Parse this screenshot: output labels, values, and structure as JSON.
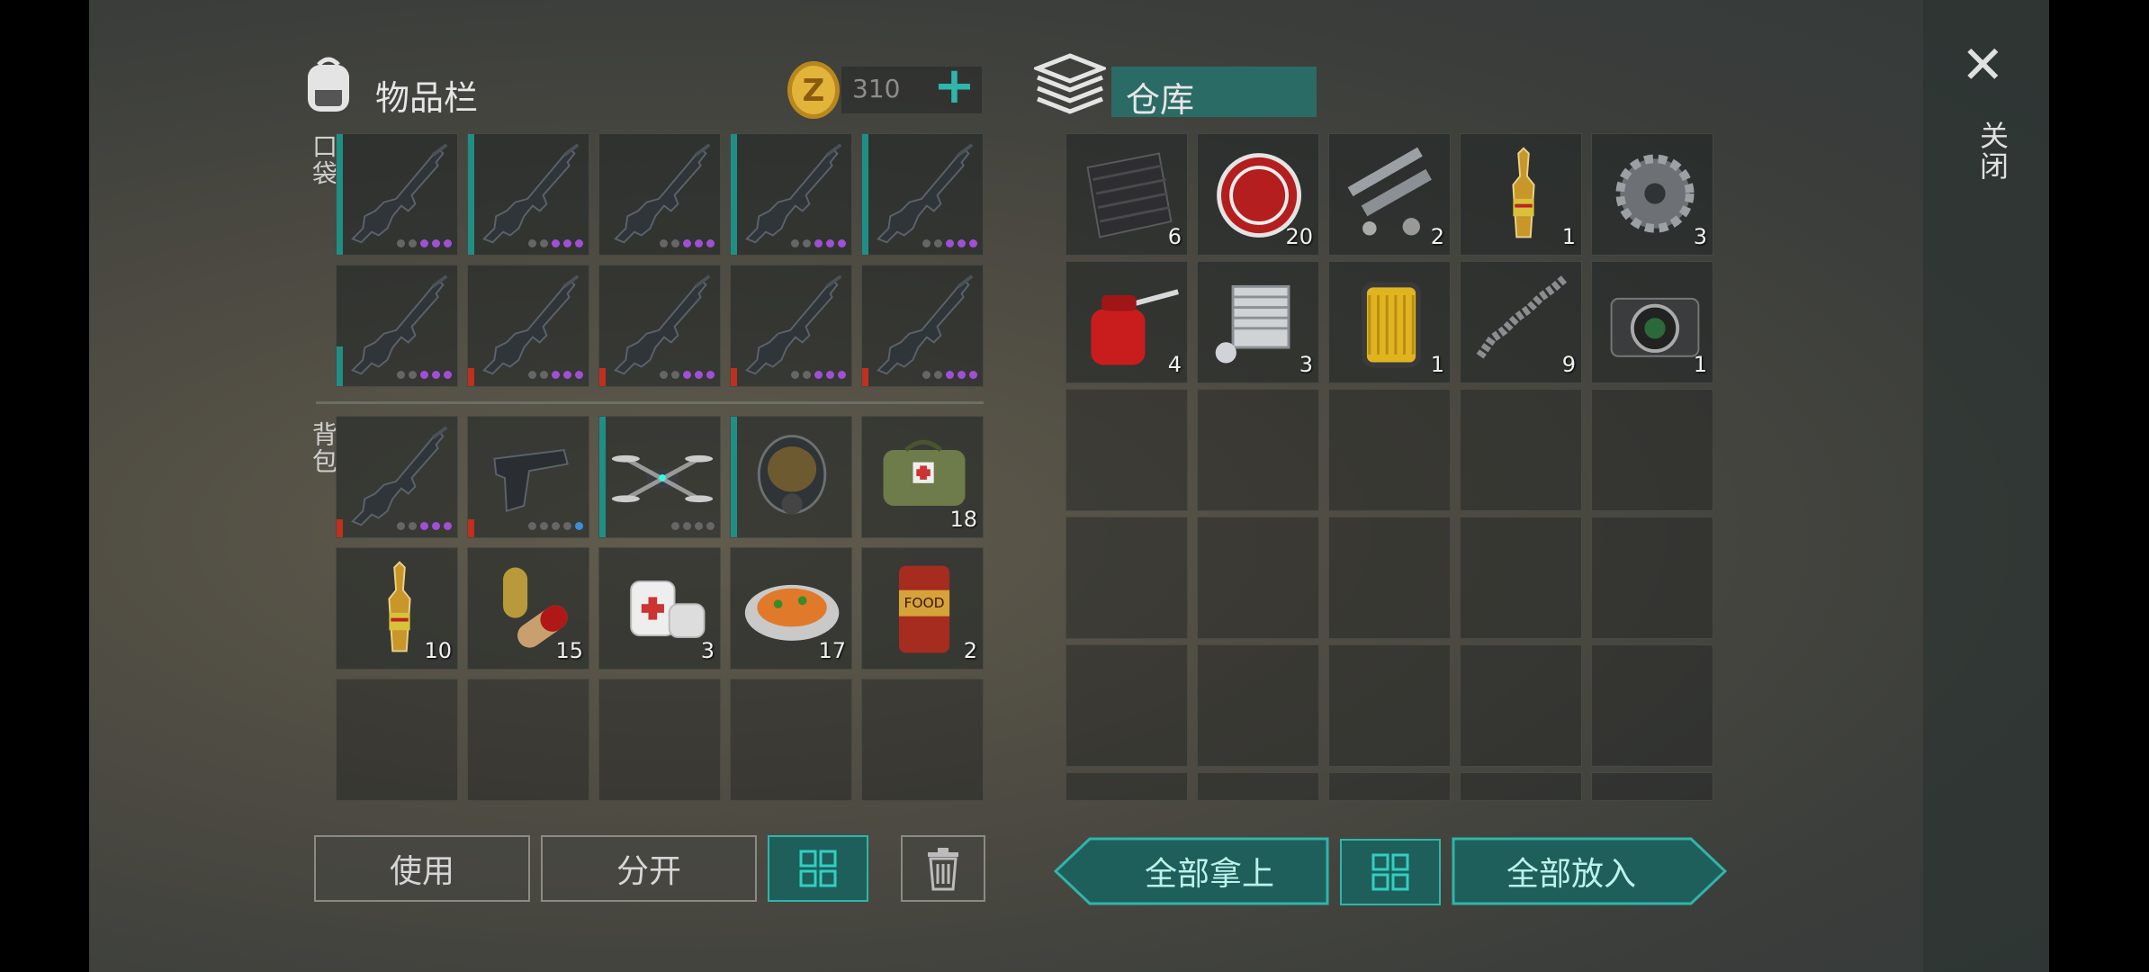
{
  "inventory": {
    "title": "物品栏",
    "pocket_label": "口袋",
    "backpack_label": "背包",
    "coins": "310",
    "coin_symbol": "Z",
    "add_symbol": "+"
  },
  "storage": {
    "title": "仓库"
  },
  "close": {
    "icon": "✕",
    "label": "关闭"
  },
  "pocket_slots": [
    {
      "icon": "rifle-icon",
      "bar": "teal",
      "dots": [
        "#666",
        "#666",
        "#a04fd6",
        "#a04fd6",
        "#a04fd6"
      ]
    },
    {
      "icon": "rifle-icon",
      "bar": "teal",
      "dots": [
        "#666",
        "#666",
        "#a04fd6",
        "#a04fd6",
        "#a04fd6"
      ]
    },
    {
      "icon": "rifle-icon",
      "bar": "none",
      "dots": [
        "#666",
        "#666",
        "#a04fd6",
        "#a04fd6",
        "#a04fd6"
      ]
    },
    {
      "icon": "rifle-icon",
      "bar": "teal",
      "dots": [
        "#666",
        "#666",
        "#a04fd6",
        "#a04fd6",
        "#a04fd6"
      ]
    },
    {
      "icon": "rifle-icon",
      "bar": "teal",
      "dots": [
        "#666",
        "#666",
        "#a04fd6",
        "#a04fd6",
        "#a04fd6"
      ]
    },
    {
      "icon": "rifle-icon",
      "bar": "teal-short",
      "dots": [
        "#666",
        "#666",
        "#a04fd6",
        "#a04fd6",
        "#a04fd6"
      ]
    },
    {
      "icon": "rifle-icon",
      "bar": "red",
      "dots": [
        "#666",
        "#666",
        "#a04fd6",
        "#a04fd6",
        "#a04fd6"
      ]
    },
    {
      "icon": "rifle-icon",
      "bar": "red",
      "dots": [
        "#666",
        "#666",
        "#a04fd6",
        "#a04fd6",
        "#a04fd6"
      ]
    },
    {
      "icon": "rifle-icon",
      "bar": "red",
      "dots": [
        "#666",
        "#666",
        "#a04fd6",
        "#a04fd6",
        "#a04fd6"
      ]
    },
    {
      "icon": "rifle-icon",
      "bar": "red",
      "dots": [
        "#666",
        "#666",
        "#a04fd6",
        "#a04fd6",
        "#a04fd6"
      ]
    }
  ],
  "backpack_slots": [
    {
      "icon": "rifle-icon",
      "bar": "red",
      "qty": "",
      "dots": [
        "#666",
        "#666",
        "#a04fd6",
        "#a04fd6",
        "#a04fd6"
      ]
    },
    {
      "icon": "pistol-icon",
      "bar": "red",
      "qty": "",
      "dots": [
        "#666",
        "#666",
        "#666",
        "#666",
        "#3a8fd8"
      ]
    },
    {
      "icon": "drone-icon",
      "bar": "teal",
      "qty": "",
      "dots": [
        "#666",
        "#666",
        "#666",
        "#666"
      ]
    },
    {
      "icon": "gas-mask-icon",
      "bar": "teal",
      "qty": "",
      "dots": []
    },
    {
      "icon": "medkit-bag-icon",
      "bar": "none",
      "qty": "18",
      "dots": []
    },
    {
      "icon": "ampoule-icon",
      "bar": "none",
      "qty": "10",
      "dots": []
    },
    {
      "icon": "pills-icon",
      "bar": "none",
      "qty": "15",
      "dots": []
    },
    {
      "icon": "bandage-icon",
      "bar": "none",
      "qty": "3",
      "dots": []
    },
    {
      "icon": "food-plate-icon",
      "bar": "none",
      "qty": "17",
      "dots": []
    },
    {
      "icon": "food-can-icon",
      "bar": "none",
      "qty": "2",
      "dots": []
    }
  ],
  "storage_slots": [
    {
      "icon": "fabric-icon",
      "qty": "6"
    },
    {
      "icon": "bottle-cap-icon",
      "qty": "20"
    },
    {
      "icon": "pipe-parts-icon",
      "qty": "2"
    },
    {
      "icon": "ampoule-icon",
      "qty": "1"
    },
    {
      "icon": "gear-icon",
      "qty": "3"
    },
    {
      "icon": "oil-can-icon",
      "qty": "4"
    },
    {
      "icon": "engine-cylinder-icon",
      "qty": "3"
    },
    {
      "icon": "oil-filter-icon",
      "qty": "1"
    },
    {
      "icon": "spring-icon",
      "qty": "9"
    },
    {
      "icon": "camera-icon",
      "qty": "1"
    }
  ],
  "buttons": {
    "use": "使用",
    "split": "分开",
    "take_all": "全部拿上",
    "put_all": "全部放入"
  },
  "icon_names": {
    "sort_left": "grid-sort-icon",
    "trash": "trash-icon",
    "sort_right": "grid-sort-icon",
    "backpack": "backpack-icon",
    "storage": "storage-box-icon",
    "coin": "coin-icon"
  }
}
